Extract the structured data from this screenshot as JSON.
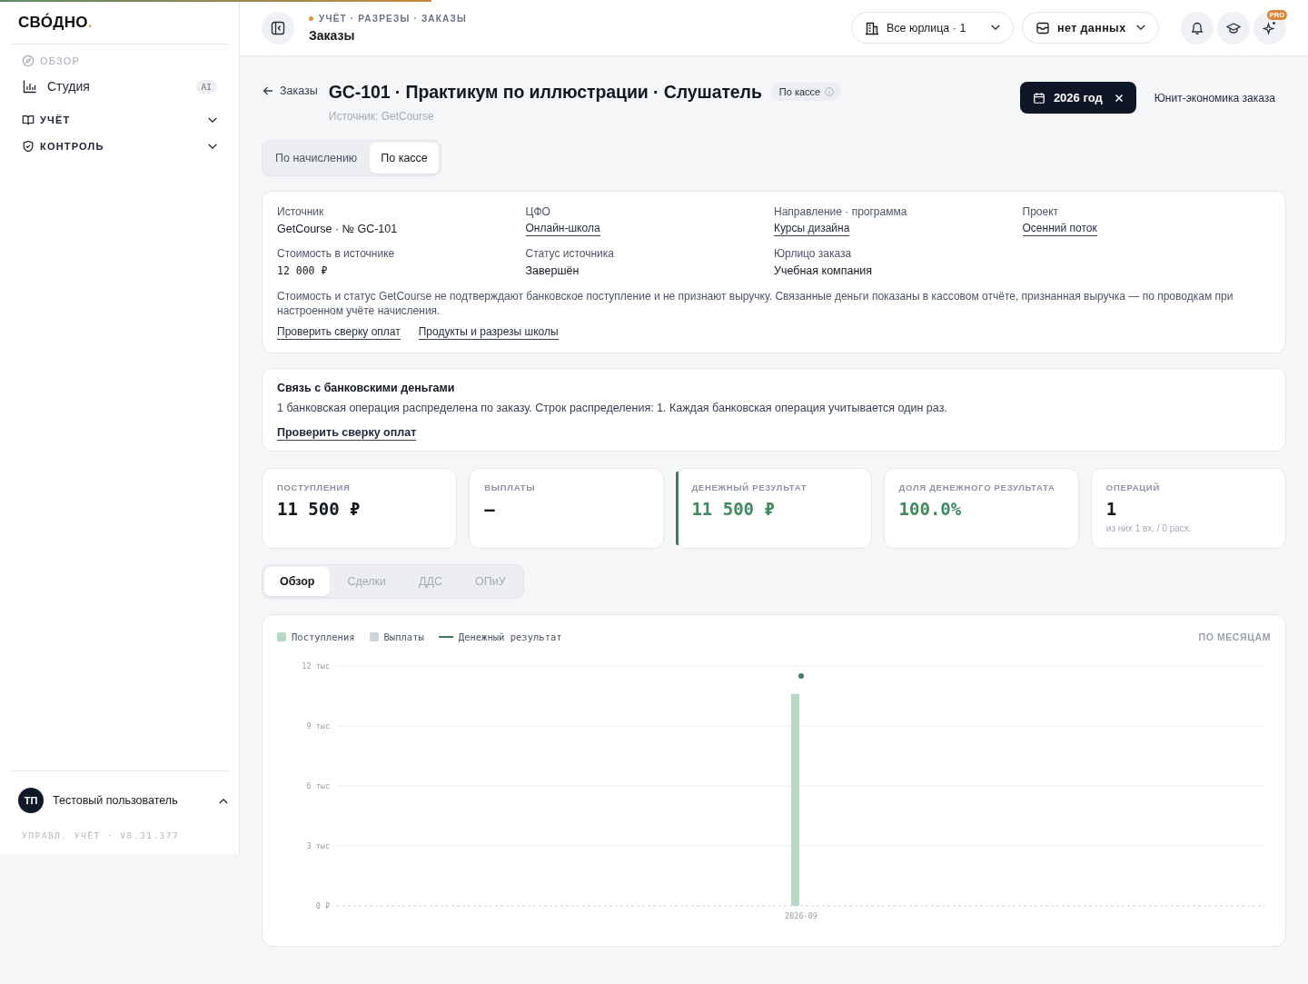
{
  "top_progress": {
    "level": 0.33
  },
  "sidebar": {
    "logo": {
      "text": "СВО́ДНО",
      "accent": "."
    },
    "nav": [
      {
        "kind": "section",
        "label": "ОБЗОР"
      },
      {
        "kind": "link",
        "label": "Студия",
        "badge": "AI"
      },
      {
        "kind": "group",
        "label": "УЧЁТ",
        "expanded": false
      },
      {
        "kind": "group",
        "label": "КОНТРОЛЬ",
        "expanded": false
      }
    ],
    "user": {
      "initials": "ТП",
      "name": "Тестовый пользователь",
      "expanded": true
    },
    "version": "УПРАВЛ. УЧЁТ · V8.31.377"
  },
  "header": {
    "breadcrumb": "УЧЁТ · РАЗРЕЗЫ · ЗАКАЗЫ",
    "title": "Заказы",
    "entity_select": {
      "value": "Все юрлица · 1"
    },
    "data_select": {
      "value": "нет данных"
    },
    "actions": [
      {
        "kind": "bell"
      },
      {
        "kind": "learn"
      },
      {
        "kind": "assistant",
        "badge": "PRO"
      }
    ]
  },
  "page": {
    "back": "Заказы",
    "title": "GC-101 · Практикум по иллюстрации · Слушатель",
    "basis_chip": "По кассе",
    "subtitle": "Источник: GetCourse",
    "period": {
      "label": "2026 год"
    },
    "unit_link": "Юнит-экономика заказа",
    "basis_tabs": [
      {
        "label": "По начислению",
        "selected": false
      },
      {
        "label": "По кассе",
        "selected": true
      }
    ]
  },
  "details": {
    "fields": [
      {
        "label": "Источник",
        "value": "GetCourse · № GC-101",
        "kind": "text"
      },
      {
        "label": "ЦФО",
        "value": "Онлайн-школа",
        "kind": "link"
      },
      {
        "label": "Направление · программа",
        "value": "Курсы дизайна",
        "kind": "link"
      },
      {
        "label": "Проект",
        "value": "Осенний поток",
        "kind": "link"
      },
      {
        "label": "Стоимость в источнике",
        "value": "12 000 ₽",
        "kind": "money"
      },
      {
        "label": "Статус источника",
        "value": "Завершён",
        "kind": "text"
      },
      {
        "label": "Юрлицо заказа",
        "value": "Учебная компания",
        "kind": "text"
      }
    ],
    "note": "Стоимость и статус GetCourse не подтверждают банковское поступление и не признают выручку. Связанные деньги показаны в кассовом отчёте, признанная выручка — по проводкам при настроенном учёте начисления.",
    "links": [
      "Проверить сверку оплат",
      "Продукты и разрезы школы"
    ]
  },
  "bank_link": {
    "title": "Связь с банковскими деньгами",
    "text": "1 банковская операция распределена по заказу. Строк распределения: 1. Каждая банковская операция учитывается один раз.",
    "link": "Проверить сверку оплат"
  },
  "kpis": [
    {
      "label": "ПОСТУПЛЕНИЯ",
      "value": "11 500 ₽",
      "positive": false,
      "highlighted": false
    },
    {
      "label": "ВЫПЛАТЫ",
      "value": "—",
      "positive": false,
      "highlighted": false
    },
    {
      "label": "ДЕНЕЖНЫЙ РЕЗУЛЬТАТ",
      "value": "11 500 ₽",
      "positive": true,
      "highlighted": true
    },
    {
      "label": "ДОЛЯ ДЕНЕЖНОГО РЕЗУЛЬТАТА",
      "value": "100.0%",
      "positive": true,
      "highlighted": false
    },
    {
      "label": "ОПЕРАЦИЙ",
      "value": "1",
      "note": "из них 1 вх. / 0 расх.",
      "positive": false,
      "highlighted": false
    }
  ],
  "tabs": [
    {
      "label": "Обзор",
      "selected": true
    },
    {
      "label": "Сделки",
      "selected": false
    },
    {
      "label": "ДДС",
      "selected": false
    },
    {
      "label": "ОПиУ",
      "selected": false
    }
  ],
  "chart": {
    "granularity": "ПО МЕСЯЦАМ",
    "chart_data": {
      "type": "bar",
      "categories": [
        "2026-09"
      ],
      "series": [
        {
          "name": "Поступления",
          "type": "bar",
          "color": "#b6d7c4",
          "values": [
            10.6
          ]
        },
        {
          "name": "Выплаты",
          "type": "bar",
          "color": "#cdd3dc",
          "values": [
            0
          ]
        },
        {
          "name": "Денежный результат",
          "type": "line",
          "color": "#3f7a5d",
          "values": [
            11.5
          ],
          "marker": true
        }
      ],
      "ylim": [
        0,
        12
      ],
      "yticks": [
        {
          "value": 0,
          "label": "0 ₽"
        },
        {
          "value": 3,
          "label": "3 тыс"
        },
        {
          "value": 6,
          "label": "6 тыс"
        },
        {
          "value": 9,
          "label": "9 тыс"
        },
        {
          "value": 12,
          "label": "12 тыс"
        }
      ],
      "grid": true
    }
  }
}
